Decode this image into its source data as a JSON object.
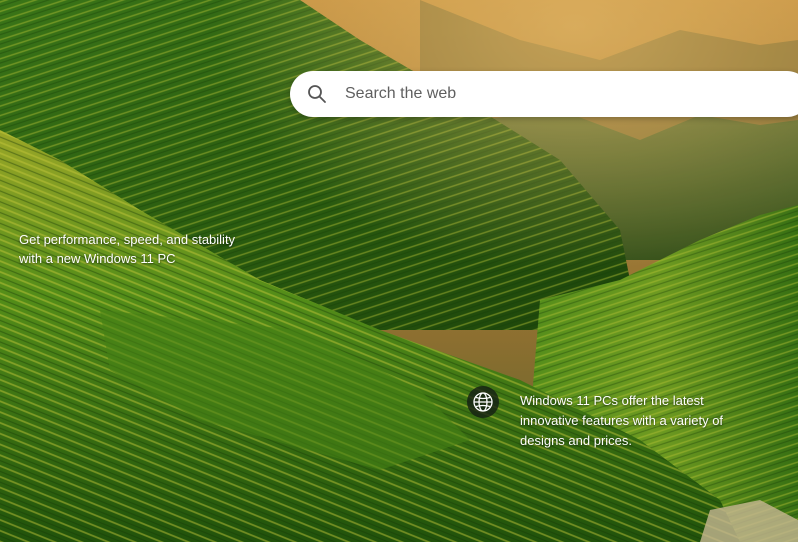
{
  "search": {
    "placeholder": "Search the web",
    "icon": "search-icon"
  },
  "promo": {
    "line1": "Get performance, speed, and stability",
    "line2": "with a new Windows 11 PC"
  },
  "info": {
    "icon": "globe-icon",
    "text": "Windows 11 PCs offer the latest innovative features with a variety of designs and prices."
  },
  "colors": {
    "search_bg": "#ffffff",
    "text": "#ffffff",
    "placeholder": "#5f5f5f"
  }
}
